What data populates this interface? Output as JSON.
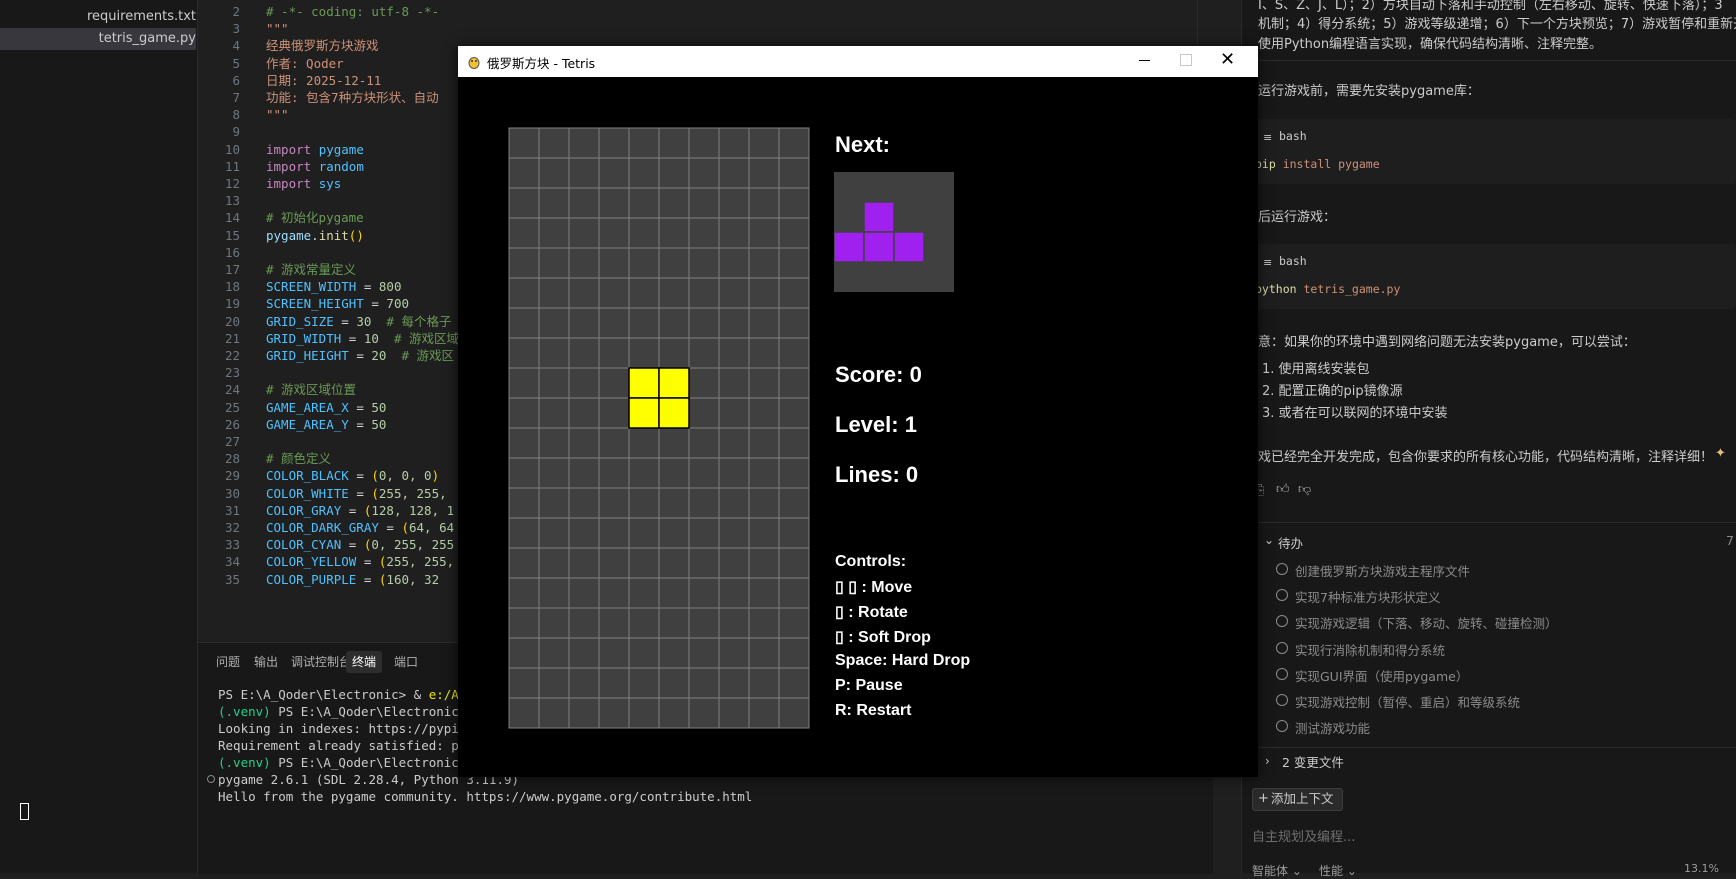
{
  "explorer": {
    "files": [
      {
        "label": "requirements.txt",
        "active": false
      },
      {
        "label": "tetris_game.py",
        "active": true
      }
    ]
  },
  "editor": {
    "lines": [
      {
        "n": "2",
        "tokens": [
          {
            "t": "# -*- coding: utf-8 -*-",
            "c": "comment"
          }
        ]
      },
      {
        "n": "3",
        "tokens": [
          {
            "t": "\"\"\"",
            "c": "string"
          }
        ]
      },
      {
        "n": "4",
        "tokens": [
          {
            "t": "经典俄罗斯方块游戏",
            "c": "string"
          }
        ]
      },
      {
        "n": "5",
        "tokens": [
          {
            "t": "作者: Qoder",
            "c": "string"
          }
        ]
      },
      {
        "n": "6",
        "tokens": [
          {
            "t": "日期: 2025-12-11",
            "c": "string"
          }
        ]
      },
      {
        "n": "7",
        "tokens": [
          {
            "t": "功能: 包含7种方块形状、自动",
            "c": "string"
          }
        ]
      },
      {
        "n": "8",
        "tokens": [
          {
            "t": "\"\"\"",
            "c": "string"
          }
        ]
      },
      {
        "n": "9",
        "tokens": []
      },
      {
        "n": "10",
        "tokens": [
          {
            "t": "import ",
            "c": "kw"
          },
          {
            "t": "pygame",
            "c": "const"
          }
        ]
      },
      {
        "n": "11",
        "tokens": [
          {
            "t": "import ",
            "c": "kw"
          },
          {
            "t": "random",
            "c": "const"
          }
        ]
      },
      {
        "n": "12",
        "tokens": [
          {
            "t": "import ",
            "c": "kw"
          },
          {
            "t": "sys",
            "c": "const"
          }
        ]
      },
      {
        "n": "13",
        "tokens": []
      },
      {
        "n": "14",
        "tokens": [
          {
            "t": "# 初始化pygame",
            "c": "comment"
          }
        ]
      },
      {
        "n": "15",
        "tokens": [
          {
            "t": "pygame",
            "c": "id"
          },
          {
            "t": ".",
            "c": "plain"
          },
          {
            "t": "init",
            "c": "fn"
          },
          {
            "t": "()",
            "c": "paren"
          }
        ]
      },
      {
        "n": "16",
        "tokens": []
      },
      {
        "n": "17",
        "tokens": [
          {
            "t": "# 游戏常量定义",
            "c": "comment"
          }
        ]
      },
      {
        "n": "18",
        "tokens": [
          {
            "t": "SCREEN_WIDTH",
            "c": "const"
          },
          {
            "t": " = ",
            "c": "plain"
          },
          {
            "t": "800",
            "c": "num"
          }
        ]
      },
      {
        "n": "19",
        "tokens": [
          {
            "t": "SCREEN_HEIGHT",
            "c": "const"
          },
          {
            "t": " = ",
            "c": "plain"
          },
          {
            "t": "700",
            "c": "num"
          }
        ]
      },
      {
        "n": "20",
        "tokens": [
          {
            "t": "GRID_SIZE",
            "c": "const"
          },
          {
            "t": " = ",
            "c": "plain"
          },
          {
            "t": "30",
            "c": "num"
          },
          {
            "t": "  # 每个格子",
            "c": "comment"
          }
        ]
      },
      {
        "n": "21",
        "tokens": [
          {
            "t": "GRID_WIDTH",
            "c": "const"
          },
          {
            "t": " = ",
            "c": "plain"
          },
          {
            "t": "10",
            "c": "num"
          },
          {
            "t": "  # 游戏区域",
            "c": "comment"
          }
        ]
      },
      {
        "n": "22",
        "tokens": [
          {
            "t": "GRID_HEIGHT",
            "c": "const"
          },
          {
            "t": " = ",
            "c": "plain"
          },
          {
            "t": "20",
            "c": "num"
          },
          {
            "t": "  # 游戏区",
            "c": "comment"
          }
        ]
      },
      {
        "n": "23",
        "tokens": []
      },
      {
        "n": "24",
        "tokens": [
          {
            "t": "# 游戏区域位置",
            "c": "comment"
          }
        ]
      },
      {
        "n": "25",
        "tokens": [
          {
            "t": "GAME_AREA_X",
            "c": "const"
          },
          {
            "t": " = ",
            "c": "plain"
          },
          {
            "t": "50",
            "c": "num"
          }
        ]
      },
      {
        "n": "26",
        "tokens": [
          {
            "t": "GAME_AREA_Y",
            "c": "const"
          },
          {
            "t": " = ",
            "c": "plain"
          },
          {
            "t": "50",
            "c": "num"
          }
        ]
      },
      {
        "n": "27",
        "tokens": []
      },
      {
        "n": "28",
        "tokens": [
          {
            "t": "# 颜色定义",
            "c": "comment"
          }
        ]
      },
      {
        "n": "29",
        "tokens": [
          {
            "t": "COLOR_BLACK",
            "c": "const"
          },
          {
            "t": " = ",
            "c": "plain"
          },
          {
            "t": "(",
            "c": "paren"
          },
          {
            "t": "0, 0, 0",
            "c": "num"
          },
          {
            "t": ")",
            "c": "paren"
          }
        ]
      },
      {
        "n": "30",
        "tokens": [
          {
            "t": "COLOR_WHITE",
            "c": "const"
          },
          {
            "t": " = ",
            "c": "plain"
          },
          {
            "t": "(",
            "c": "paren"
          },
          {
            "t": "255, 255,",
            "c": "num"
          }
        ]
      },
      {
        "n": "31",
        "tokens": [
          {
            "t": "COLOR_GRAY",
            "c": "const"
          },
          {
            "t": " = ",
            "c": "plain"
          },
          {
            "t": "(",
            "c": "paren"
          },
          {
            "t": "128, 128, 1",
            "c": "num"
          }
        ]
      },
      {
        "n": "32",
        "tokens": [
          {
            "t": "COLOR_DARK_GRAY",
            "c": "const"
          },
          {
            "t": " = ",
            "c": "plain"
          },
          {
            "t": "(",
            "c": "paren"
          },
          {
            "t": "64, 64",
            "c": "num"
          }
        ]
      },
      {
        "n": "33",
        "tokens": [
          {
            "t": "COLOR_CYAN",
            "c": "const"
          },
          {
            "t": " = ",
            "c": "plain"
          },
          {
            "t": "(",
            "c": "paren"
          },
          {
            "t": "0, 255, 255",
            "c": "num"
          }
        ]
      },
      {
        "n": "34",
        "tokens": [
          {
            "t": "COLOR_YELLOW",
            "c": "const"
          },
          {
            "t": " = ",
            "c": "plain"
          },
          {
            "t": "(",
            "c": "paren"
          },
          {
            "t": "255, 255,",
            "c": "num"
          }
        ]
      },
      {
        "n": "35",
        "tokens": [
          {
            "t": "COLOR_PURPLE",
            "c": "const"
          },
          {
            "t": " = ",
            "c": "plain"
          },
          {
            "t": "(",
            "c": "paren"
          },
          {
            "t": "160, 32",
            "c": "num"
          }
        ]
      }
    ]
  },
  "panel": {
    "tabs": [
      {
        "label": "问题",
        "active": false
      },
      {
        "label": "输出",
        "active": false
      },
      {
        "label": "调试控制台",
        "active": false
      },
      {
        "label": "终端",
        "active": true
      },
      {
        "label": "端口",
        "active": false
      }
    ],
    "terminal_lines": [
      [
        {
          "t": "PS E:\\A_Qoder\\Electronic> & ",
          "c": "#cccccc"
        },
        {
          "t": "e:/A_Q",
          "c": "#e5e510"
        }
      ],
      [
        {
          "t": "(.venv) ",
          "c": "#23d18b"
        },
        {
          "t": "PS E:\\A_Qoder\\Electronic> p",
          "c": "#cccccc"
        }
      ],
      [
        {
          "t": "Looking in indexes: https://pypi.t",
          "c": "#cccccc"
        }
      ],
      [
        {
          "t": "Requirement already satisfied: pyg",
          "c": "#cccccc"
        }
      ],
      [
        {
          "t": "(.venv) ",
          "c": "#23d18b"
        },
        {
          "t": "PS E:\\A_Qoder\\Electronic> p",
          "c": "#cccccc"
        }
      ],
      [
        {
          "t": "pygame 2.6.1 (SDL 2.28.4, Python 3.11.9)",
          "c": "#cccccc"
        }
      ],
      [
        {
          "t": "Hello from the pygame community. https://www.pygame.org/contribute.html",
          "c": "#cccccc"
        }
      ]
    ]
  },
  "chat": {
    "top_line1": "I、S、Z、J、L）；2）方块自动下落和手动控制（左右移动、旋转、快速下落）；3",
    "top_line2": "机制；4）得分系统；5）游戏等级递增；6）下一个方块预览；7）游戏暂停和重新开始",
    "top_line3": "使用Python编程语言实现，确保代码结构清晰、注释完整。",
    "install_intro": "运行游戏前，需要先安装pygame库：",
    "bash_label": "bash",
    "cmd_install_kw": "pip",
    "cmd_install_rest": " install pygame",
    "run_intro": "后运行游戏：",
    "cmd_run_kw": "python",
    "cmd_run_rest": " tetris_game.py",
    "note": "意：如果你的环境中遇到网络问题无法安装pygame，可以尝试：",
    "note_items": [
      "1. 使用离线安装包",
      "2. 配置正确的pip镜像源",
      "3. 或者在可以联网的环境中安装"
    ],
    "summary": "戏已经完全开发完成，包含你要求的所有核心功能，代码结构清晰，注释详细！",
    "todo_header": "待办",
    "todo_count": "7",
    "todos": [
      "创建俄罗斯方块游戏主程序文件",
      "实现7种标准方块形状定义",
      "实现游戏逻辑（下落、移动、旋转、碰撞检测）",
      "实现行消除机制和得分系统",
      "实现GUI界面（使用pygame）",
      "实现游戏控制（暂停、重启）和等级系统",
      "测试游戏功能"
    ],
    "changed_files": "2 变更文件",
    "add_context": "添加上下文",
    "input_placeholder": "自主规划及编程...",
    "footer_left1": "智能体",
    "footer_left2": "性能",
    "footer_right": "13.1%"
  },
  "tetris": {
    "window_title": "俄罗斯方块 - Tetris",
    "next_label": "Next:",
    "score_label": "Score: 0",
    "level_label": "Level: 1",
    "lines_label": "Lines: 0",
    "controls_header": "Controls:",
    "controls": [
      "▯ ▯ : Move",
      "▯ : Rotate",
      "▯ : Soft Drop",
      "Space: Hard Drop",
      "P: Pause",
      "R: Restart"
    ],
    "colors": {
      "cell": "#404040",
      "grid_line": "#808080",
      "yellow": "#ffff00",
      "purple": "#a020f0",
      "preview_bg": "#404040"
    },
    "grid": {
      "cols": 10,
      "rows": 20
    },
    "active_piece": {
      "shape": "O",
      "cells": [
        [
          4,
          8
        ],
        [
          5,
          8
        ],
        [
          4,
          9
        ],
        [
          5,
          9
        ]
      ]
    },
    "next_piece": {
      "shape": "T",
      "cells": [
        [
          1,
          0
        ],
        [
          0,
          1
        ],
        [
          1,
          1
        ],
        [
          2,
          1
        ]
      ]
    }
  }
}
